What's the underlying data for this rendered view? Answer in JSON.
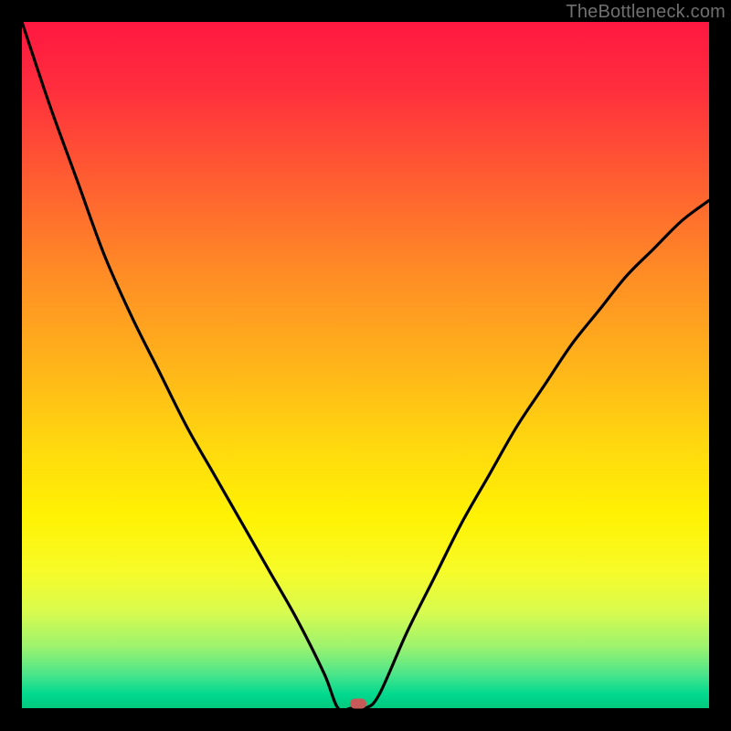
{
  "watermark": "TheBottleneck.com",
  "chart_data": {
    "type": "line",
    "title": "",
    "xlabel": "",
    "ylabel": "",
    "x": [
      0.0,
      0.04,
      0.08,
      0.12,
      0.16,
      0.2,
      0.24,
      0.28,
      0.32,
      0.36,
      0.4,
      0.44,
      0.46,
      0.48,
      0.5,
      0.52,
      0.56,
      0.6,
      0.64,
      0.68,
      0.72,
      0.76,
      0.8,
      0.84,
      0.88,
      0.92,
      0.96,
      1.0
    ],
    "values": [
      1.0,
      0.88,
      0.77,
      0.66,
      0.57,
      0.49,
      0.41,
      0.34,
      0.27,
      0.2,
      0.13,
      0.05,
      0.0,
      0.0,
      0.0,
      0.02,
      0.11,
      0.19,
      0.27,
      0.34,
      0.41,
      0.47,
      0.53,
      0.58,
      0.63,
      0.67,
      0.71,
      0.74
    ],
    "xlim": [
      0,
      1
    ],
    "ylim": [
      0,
      1
    ],
    "grid": false,
    "marker": {
      "x": 0.49,
      "y": 0.0,
      "color": "#c65a58"
    },
    "background_gradient": {
      "direction": "vertical",
      "stops": [
        {
          "pos": 0.0,
          "color": "#ff1741"
        },
        {
          "pos": 0.5,
          "color": "#ffb41a"
        },
        {
          "pos": 0.8,
          "color": "#f7fb28"
        },
        {
          "pos": 1.0,
          "color": "#00c97e"
        }
      ]
    }
  }
}
